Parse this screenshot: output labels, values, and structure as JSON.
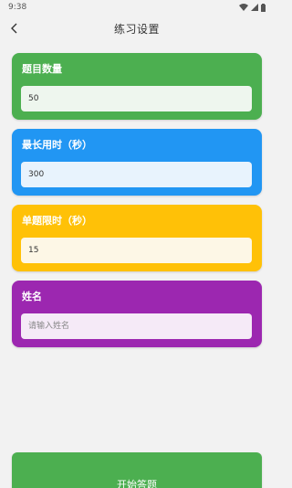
{
  "status_bar": {
    "time": "9:38"
  },
  "header": {
    "title": "练习设置",
    "back_icon": "chevron-left-icon"
  },
  "cards": [
    {
      "label": "题目数量",
      "value": "50",
      "placeholder": "",
      "color": "#4caf50",
      "input_bg": "#eef6ee"
    },
    {
      "label": "最长用时（秒）",
      "value": "300",
      "placeholder": "",
      "color": "#2196f3",
      "input_bg": "#e8f3fd"
    },
    {
      "label": "单题限时（秒）",
      "value": "15",
      "placeholder": "",
      "color": "#ffc107",
      "input_bg": "#fdf7e6"
    },
    {
      "label": "姓名",
      "value": "",
      "placeholder": "请输入姓名",
      "color": "#9c27b0",
      "input_bg": "#f5eaf7"
    }
  ],
  "start_button": {
    "label": "开始答题",
    "color": "#4caf50"
  }
}
